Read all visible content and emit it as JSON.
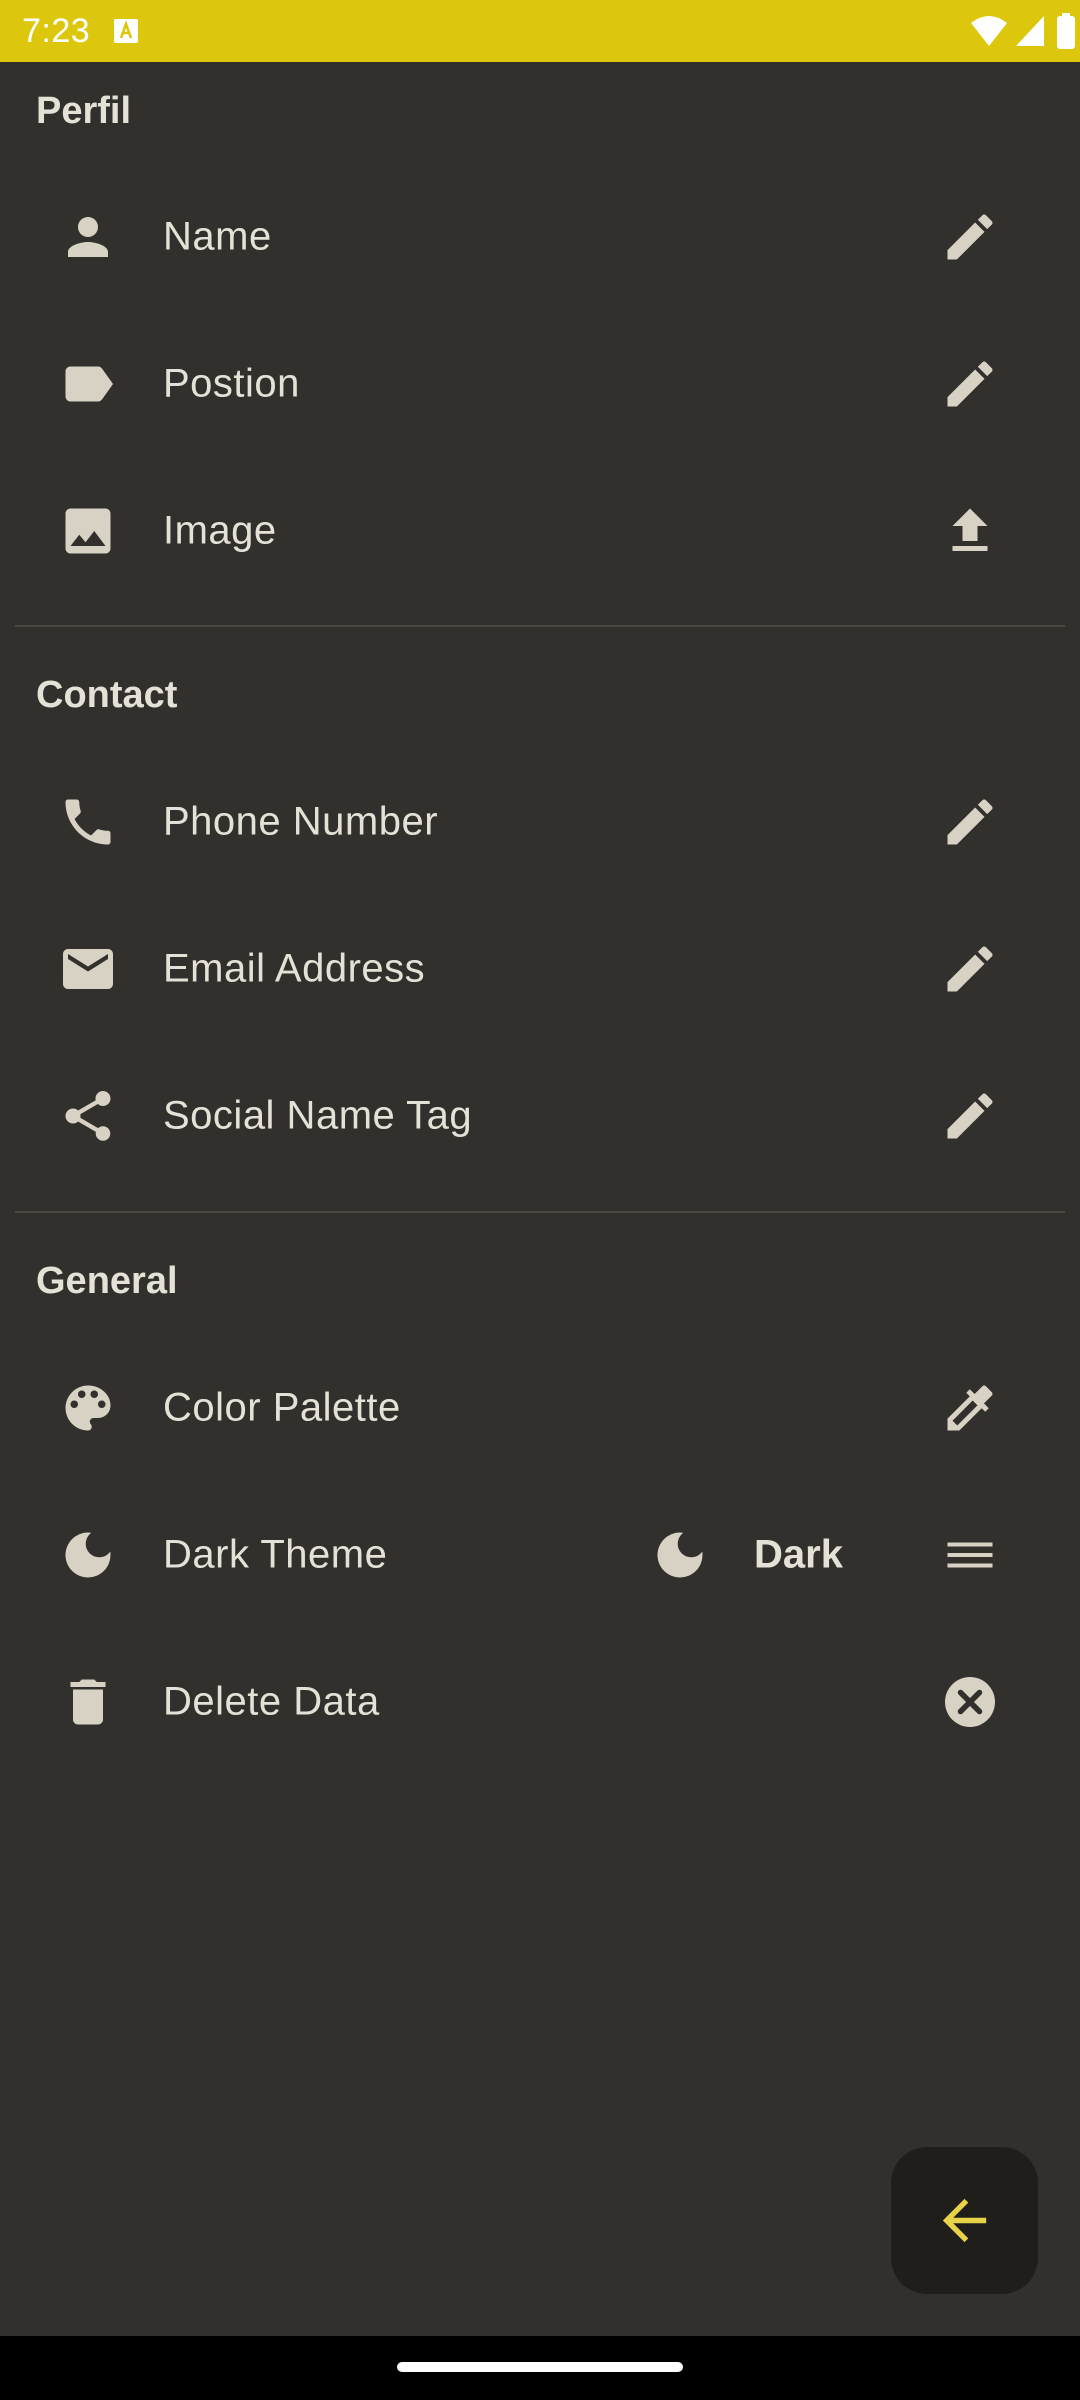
{
  "status_bar": {
    "time": "7:23",
    "background_color": "#dcc70c"
  },
  "sections": {
    "profile": {
      "title": "Perfil",
      "items": [
        {
          "label": "Name",
          "icon": "person-icon",
          "action_icon": "edit-icon"
        },
        {
          "label": "Postion",
          "icon": "label-icon",
          "action_icon": "edit-icon"
        },
        {
          "label": "Image",
          "icon": "image-icon",
          "action_icon": "upload-icon"
        }
      ]
    },
    "contact": {
      "title": "Contact",
      "items": [
        {
          "label": "Phone Number",
          "icon": "phone-icon",
          "action_icon": "edit-icon"
        },
        {
          "label": "Email Address",
          "icon": "email-icon",
          "action_icon": "edit-icon"
        },
        {
          "label": "Social Name Tag",
          "icon": "share-icon",
          "action_icon": "edit-icon"
        }
      ]
    },
    "general": {
      "title": "General",
      "items": [
        {
          "label": "Color Palette",
          "icon": "palette-icon",
          "action_icon": "eyedropper-icon"
        },
        {
          "label": "Dark Theme",
          "icon": "moon-icon",
          "value": "Dark",
          "value_icon": "moon-icon",
          "action_icon": "menu-icon"
        },
        {
          "label": "Delete Data",
          "icon": "trash-icon",
          "action_icon": "cancel-icon"
        }
      ]
    }
  },
  "fab": {
    "icon": "arrow-back-icon",
    "icon_color": "#e8d24a"
  },
  "colors": {
    "background": "#31302c",
    "text": "#e6e1d6",
    "icon": "#d8d2c4",
    "accent": "#dcc70c"
  }
}
